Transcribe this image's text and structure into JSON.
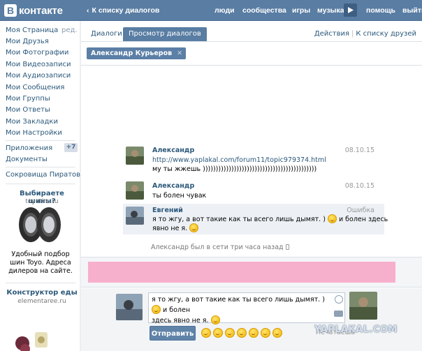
{
  "topbar": {
    "logo_mark": "В",
    "logo_text": "контакте",
    "back_link": "К списку диалогов",
    "nav": [
      "люди",
      "сообщества",
      "игры",
      "музыка",
      "помощь",
      "выйти"
    ]
  },
  "sidebar": {
    "edit_label": "ред.",
    "items": [
      "Моя Страница",
      "Мои Друзья",
      "Мои Фотографии",
      "Мои Видеозаписи",
      "Мои Аудиозаписи",
      "Мои Сообщения",
      "Мои Группы",
      "Мои Ответы",
      "Мои Закладки",
      "Мои Настройки"
    ],
    "apps_label": "Приложения",
    "apps_badge": "+7",
    "docs_label": "Документы",
    "treasures_label": "Сокровища Пиратов",
    "ad1": {
      "title": "Выбираете шины?",
      "domain": "toyotire.ru",
      "text": "Удобный подбор шин Toyo. Адреса дилеров на сайте."
    },
    "ad2": {
      "title": "Конструктор еды",
      "domain": "elementaree.ru"
    }
  },
  "main": {
    "tabs": [
      "Диалоги",
      "Просмотр диалогов"
    ],
    "right_links": [
      "Действия",
      "К списку друзей"
    ],
    "filter_token": "Александр Курьеров",
    "messages": [
      {
        "author": "Александр",
        "date": "08.10.15",
        "link": "http://www.yaplakal.com/forum11/topic979374.html",
        "text": "му ты жжешь ))))))))))))))))))))))))))))))))))))))))))))"
      },
      {
        "author": "Александр",
        "date": "08.10.15",
        "text": "ты болен чувак"
      },
      {
        "author": "Евгений",
        "date": "Ошибка",
        "text_line1": "я то жгу, а вот такие как ты всего лишь дымят. )",
        "text_line1b": "и болен здесь",
        "text_line2": "явно не я."
      }
    ],
    "online_note": "Александр был в сети три часа назад"
  },
  "compose": {
    "text_line1": "я то жгу, а вот такие как ты всего лишь дымят. )",
    "text_line1b": "и болен",
    "text_line2": "здесь явно не я.",
    "send_label": "Отправить",
    "hint": "Печатаешь"
  },
  "watermark": "YAPLAKAL.COM",
  "colors": {
    "topbar": "#597da3",
    "link": "#2b587a",
    "highlight": "#f7b0cb"
  }
}
